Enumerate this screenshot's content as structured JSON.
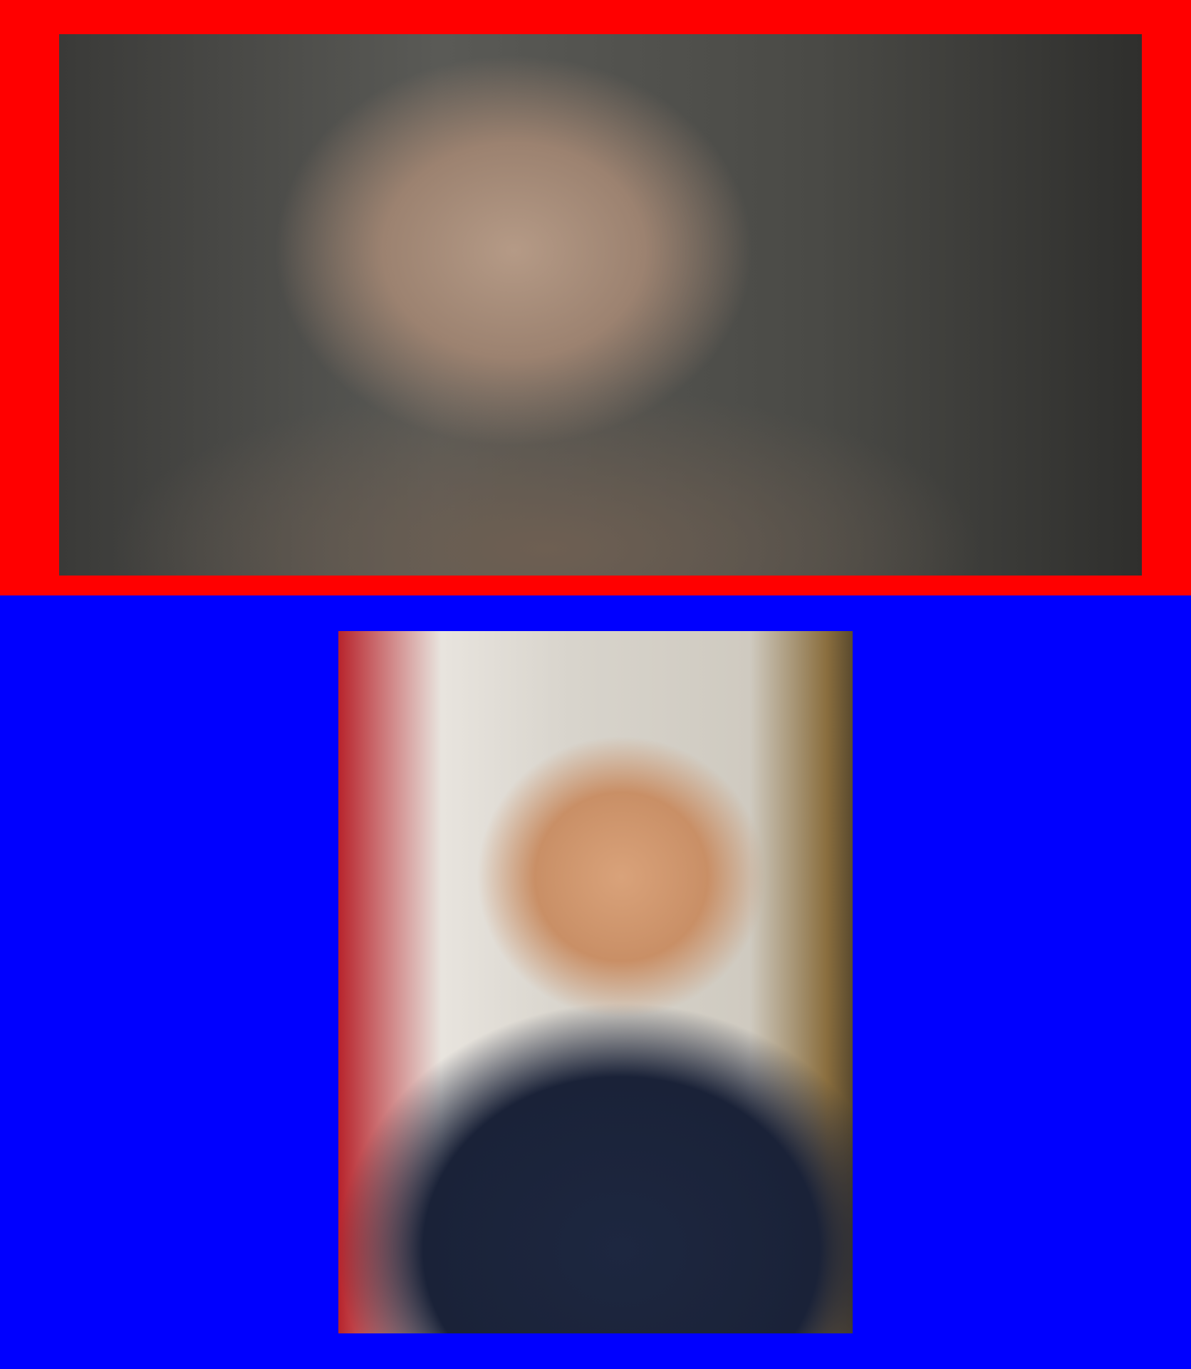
{
  "colors": {
    "top_frame": "#ff0000",
    "bottom_background": "#0000ff"
  },
  "photos": [
    {
      "slot": "top",
      "depicts": "man-in-glasses-tweed-jacket"
    },
    {
      "slot": "bottom",
      "depicts": "man-in-navy-suit-with-flag"
    }
  ]
}
